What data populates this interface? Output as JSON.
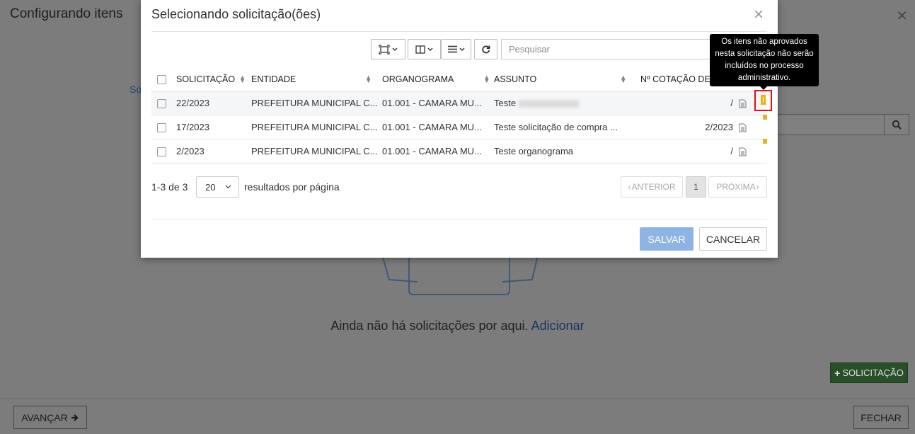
{
  "background": {
    "title": "Configurando itens",
    "close_glyph": "✕",
    "tab_partial": "So",
    "empty_message": "Ainda não há solicitações por aqui.",
    "empty_link": "Adicionar",
    "add_button": "SOLICITAÇÃO",
    "next_button": "AVANÇAR",
    "close_button": "FECHAR"
  },
  "modal": {
    "title": "Selecionando solicitação(ões)",
    "close_glyph": "×",
    "search_placeholder": "Pesquisar",
    "columns": [
      "SOLICITAÇÃO",
      "ENTIDADE",
      "ORGANOGRAMA",
      "ASSUNTO",
      "Nº COTAÇÃO DE PR"
    ],
    "rows": [
      {
        "solicitacao": "22/2023",
        "entidade": "PREFEITURA MUNICIPAL C...",
        "organograma": "01.001 - CAMARA MU...",
        "assunto": "Teste",
        "cotacao": "/",
        "highlighted": true
      },
      {
        "solicitacao": "17/2023",
        "entidade": "PREFEITURA MUNICIPAL C...",
        "organograma": "01.001 - CAMARA MU...",
        "assunto": "Teste solicitação de compra ...",
        "cotacao": "2/2023",
        "highlighted": false
      },
      {
        "solicitacao": "2/2023",
        "entidade": "PREFEITURA MUNICIPAL C...",
        "organograma": "01.001 - CAMARA MU...",
        "assunto": "Teste organograma",
        "cotacao": "/",
        "highlighted": false
      }
    ],
    "pagination": {
      "range": "1-3 de 3",
      "per_page": "20",
      "per_page_label": "resultados por página",
      "prev": "ANTERIOR",
      "current": "1",
      "next": "PRÓXIMA"
    },
    "save_button": "SALVAR",
    "cancel_button": "CANCELAR"
  },
  "tooltip": {
    "text": "Os itens não aprovados nesta solicitação não serão incluídos no processo administrativo."
  },
  "colors": {
    "warning": "#e8b419",
    "save_disabled": "#8eb4e3",
    "add_green": "#294f29",
    "highlight_red": "#e01010"
  }
}
